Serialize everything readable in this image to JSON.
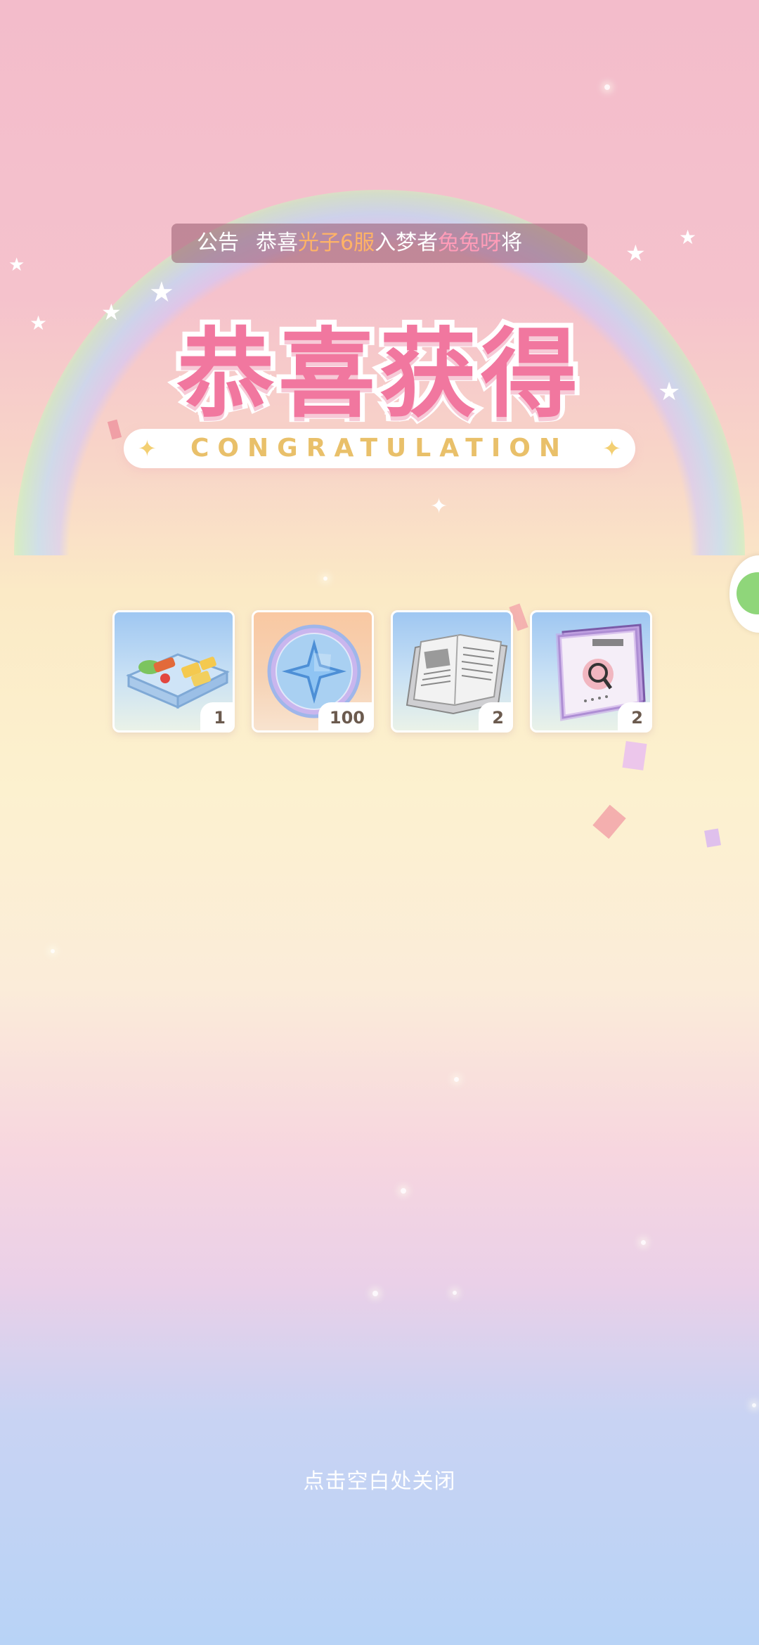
{
  "notice": {
    "label": "公告",
    "prefix": "恭喜",
    "server": "光子6服",
    "middle": "入梦者",
    "player": "兔兔呀",
    "suffix": "将"
  },
  "title": {
    "main": "恭喜获得",
    "subtitle": "CONGRATULATION"
  },
  "rewards": [
    {
      "name": "bento-box",
      "icon": "bento-icon",
      "quantity": "1"
    },
    {
      "name": "star-coin",
      "icon": "compass-star-coin-icon",
      "quantity": "100"
    },
    {
      "name": "newspaper",
      "icon": "newspaper-icon",
      "quantity": "2"
    },
    {
      "name": "magazine",
      "icon": "magnifier-book-icon",
      "quantity": "2"
    }
  ],
  "close_hint": "点击空白处关闭",
  "colors": {
    "title_pink": "#f1779f",
    "subtitle_gold": "#e9c06a",
    "notice_orange": "#ffb366",
    "notice_pink": "#ff9cb8"
  }
}
